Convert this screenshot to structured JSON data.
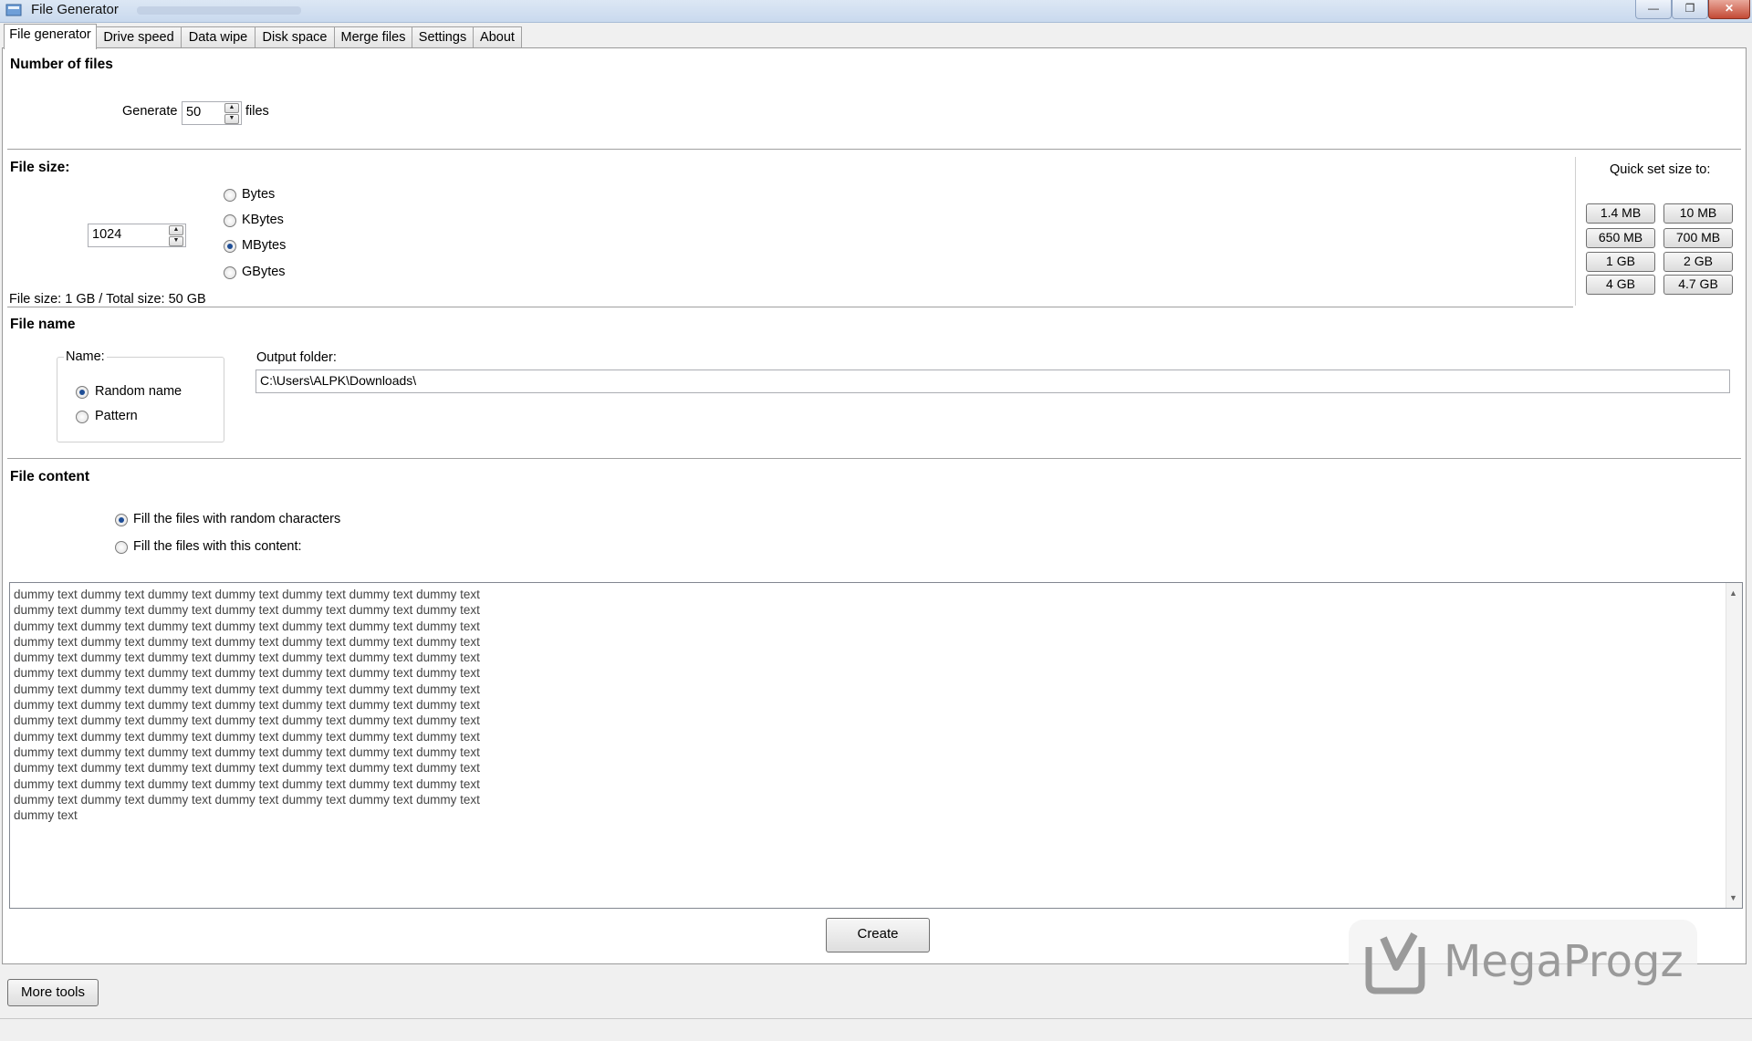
{
  "window": {
    "title": "File Generator",
    "min_glyph": "—",
    "max_glyph": "❐",
    "close_glyph": "✕",
    "icon": "app-icon"
  },
  "tabs": [
    {
      "label": "File generator",
      "active": true
    },
    {
      "label": "Drive speed"
    },
    {
      "label": "Data wipe"
    },
    {
      "label": "Disk space"
    },
    {
      "label": "Merge files"
    },
    {
      "label": "Settings"
    },
    {
      "label": "About"
    }
  ],
  "number_of_files": {
    "heading": "Number of files",
    "generate_label": "Generate",
    "count": "50",
    "suffix": "files"
  },
  "file_size": {
    "heading": "File size:",
    "value": "1024",
    "units": [
      {
        "label": "Bytes",
        "selected": false
      },
      {
        "label": "KBytes",
        "selected": false
      },
      {
        "label": "MBytes",
        "selected": true
      },
      {
        "label": "GBytes",
        "selected": false
      }
    ],
    "summary": "File size: 1 GB / Total size: 50 GB",
    "quick_set_label": "Quick set size to:",
    "quick_buttons": [
      "1.4 MB",
      "10 MB",
      "650 MB",
      "700 MB",
      "1 GB",
      "2 GB",
      "4 GB",
      "4.7 GB"
    ]
  },
  "file_name": {
    "heading": "File name",
    "name_group_label": "Name:",
    "options": [
      {
        "label": "Random name",
        "selected": true
      },
      {
        "label": "Pattern",
        "selected": false
      }
    ],
    "output_folder_label": "Output folder:",
    "output_folder": "C:\\Users\\ALPK\\Downloads\\"
  },
  "file_content": {
    "heading": "File content",
    "options": [
      {
        "label": "Fill the files with random characters",
        "selected": true
      },
      {
        "label": "Fill the files with this content:",
        "selected": false
      }
    ],
    "content": "dummy text dummy text dummy text dummy text dummy text dummy text dummy text\ndummy text dummy text dummy text dummy text dummy text dummy text dummy text\ndummy text dummy text dummy text dummy text dummy text dummy text dummy text\ndummy text dummy text dummy text dummy text dummy text dummy text dummy text\ndummy text dummy text dummy text dummy text dummy text dummy text dummy text\ndummy text dummy text dummy text dummy text dummy text dummy text dummy text\ndummy text dummy text dummy text dummy text dummy text dummy text dummy text\ndummy text dummy text dummy text dummy text dummy text dummy text dummy text\ndummy text dummy text dummy text dummy text dummy text dummy text dummy text\ndummy text dummy text dummy text dummy text dummy text dummy text dummy text\ndummy text dummy text dummy text dummy text dummy text dummy text dummy text\ndummy text dummy text dummy text dummy text dummy text dummy text dummy text\ndummy text dummy text dummy text dummy text dummy text dummy text dummy text\ndummy text dummy text dummy text dummy text dummy text dummy text dummy text\ndummy text"
  },
  "actions": {
    "create": "Create",
    "more_tools": "More tools"
  },
  "watermark": {
    "text": "MegaProgz"
  },
  "colors": {
    "radio_selected": "#1f4e96",
    "close_button": "#c44a35"
  }
}
